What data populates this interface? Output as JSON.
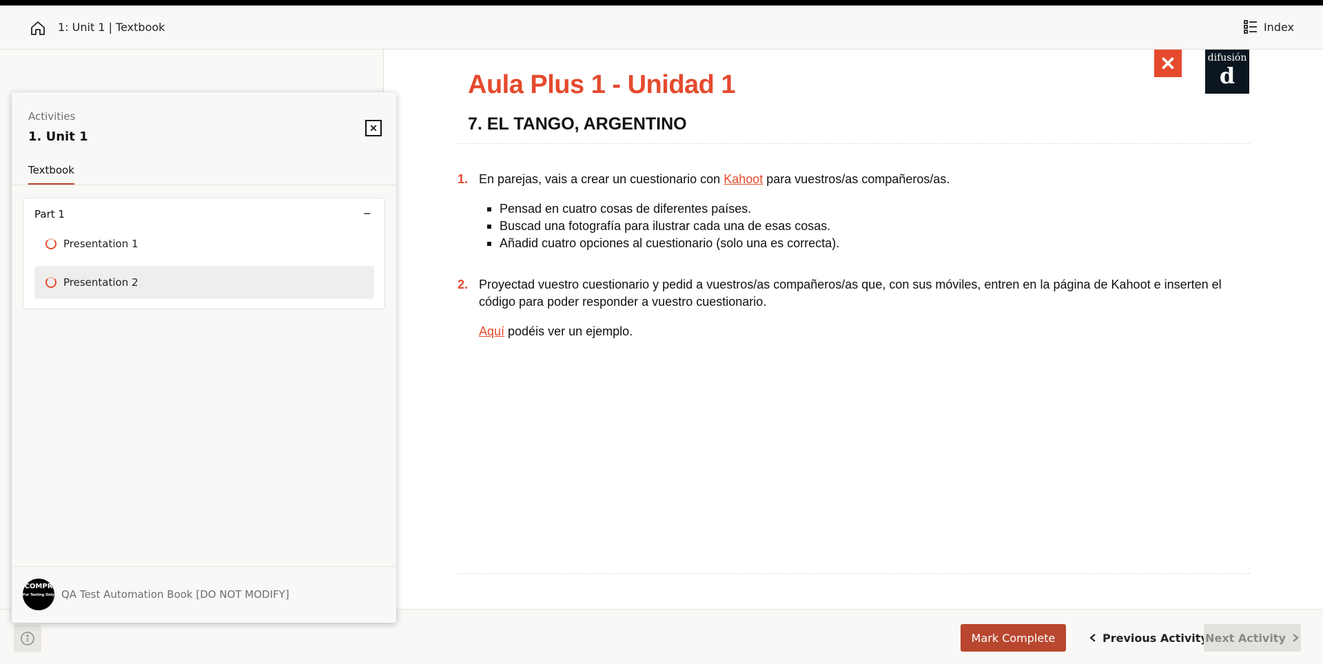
{
  "header": {
    "breadcrumb": "1: Unit 1 | Textbook",
    "index_label": "Index"
  },
  "content": {
    "unit_title": "Aula Plus 1 - Unidad 1",
    "section_title": "7. EL TANGO, ARGENTINO",
    "logo_word": "difusión",
    "logo_mark": "d",
    "activity1": {
      "number": "1.",
      "text_before": "En parejas, vais a crear un cuestionario con ",
      "link": "Kahoot",
      "text_after": " para vuestros/as compañeros/as.",
      "bullets": [
        "Pensad en cuatro cosas de diferentes países.",
        "Buscad una fotografía para ilustrar cada una de esas cosas.",
        "Añadid cuatro opciones al cuestionario (solo una es correcta)."
      ]
    },
    "activity2": {
      "number": "2.",
      "text": "Proyectad vuestro cuestionario y pedid a vuestros/as compañeros/as que, con sus móviles, entren en la página de Kahoot e inserten el código para poder responder a vuestro cuestionario.",
      "example_link": "Aquí",
      "example_text": " podéis ver un ejemplo."
    }
  },
  "panel": {
    "eyebrow": "Activities",
    "title": "1. Unit 1",
    "tab": "Textbook",
    "part": {
      "label": "Part 1",
      "items": [
        "Presentation 1",
        "Presentation 2"
      ]
    },
    "avatar_text": "COMPR",
    "avatar_sub": "For Testing Only",
    "book_name": "QA Test Automation Book [DO NOT MODIFY]"
  },
  "footer": {
    "mark_complete": "Mark Complete",
    "previous": "Previous Activity",
    "next": "Next Activity"
  },
  "colors": {
    "accent": "#e54a2e",
    "button": "#b9472f",
    "logo_bg": "#0b1620"
  },
  "icons": {
    "home": "home-icon",
    "index": "list-icon",
    "close": "close-icon",
    "info": "info-icon",
    "chevron_left": "chevron-left-icon",
    "chevron_right": "chevron-right-icon",
    "collapse": "minus-icon",
    "progress": "progress-ring-icon"
  }
}
